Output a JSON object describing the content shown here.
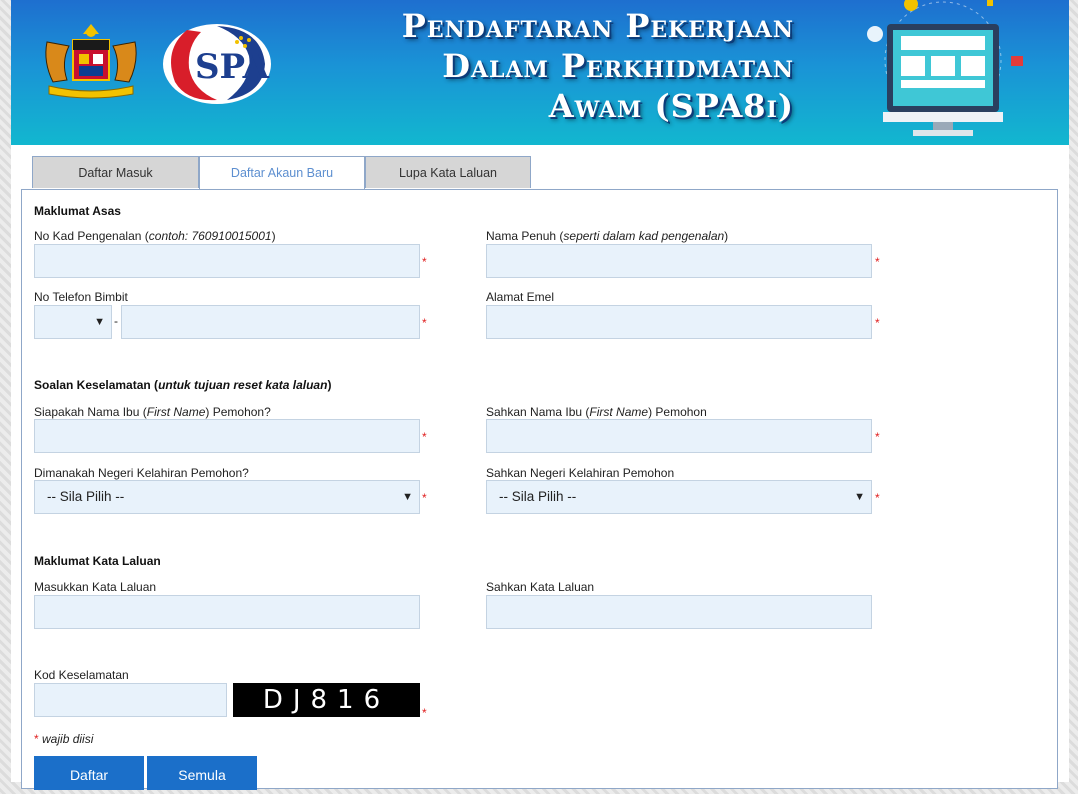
{
  "header": {
    "title_lines": [
      "Pendaftaran Pekerjaan",
      "Dalam Perkhidmatan",
      "Awam (SPA8i)"
    ],
    "brand_colors": {
      "top": "#1e6fcf",
      "bottom": "#12b7cf"
    },
    "logo_text": "SPA"
  },
  "tabs": [
    {
      "label": "Daftar Masuk",
      "active": false
    },
    {
      "label": "Daftar Akaun Baru",
      "active": true
    },
    {
      "label": "Lupa Kata Laluan",
      "active": false
    }
  ],
  "sections": {
    "basic": "Maklumat Asas",
    "security": "Soalan Keselamatan",
    "security_note": "untuk tujuan reset kata laluan",
    "password": "Maklumat Kata Laluan"
  },
  "fields": {
    "ic": {
      "label": "No Kad Pengenalan",
      "hint": "contoh: 760910015001"
    },
    "name": {
      "label": "Nama Penuh",
      "hint": "seperti dalam kad pengenalan"
    },
    "phone": {
      "label": "No Telefon Bimbit",
      "separator": "-"
    },
    "email": {
      "label": "Alamat Emel"
    },
    "mother": {
      "label_pre": "Siapakah Nama Ibu (",
      "label_em": "First Name",
      "label_post": ") Pemohon?"
    },
    "mother_confirm": {
      "label_pre": "Sahkan Nama Ibu (",
      "label_em": "First Name",
      "label_post": ") Pemohon"
    },
    "state": {
      "label": "Dimanakah Negeri Kelahiran Pemohon?",
      "value": "-- Sila Pilih --"
    },
    "state_confirm": {
      "label": "Sahkan Negeri Kelahiran Pemohon",
      "value": "-- Sila Pilih --"
    },
    "password": {
      "label": "Masukkan Kata Laluan"
    },
    "password_confirm": {
      "label": "Sahkan Kata Laluan"
    },
    "captcha": {
      "label": "Kod Keselamatan",
      "code": "DJ816"
    }
  },
  "required_mark": "*",
  "required_note": "wajib diisi",
  "buttons": {
    "submit": "Daftar",
    "reset": "Semula"
  }
}
